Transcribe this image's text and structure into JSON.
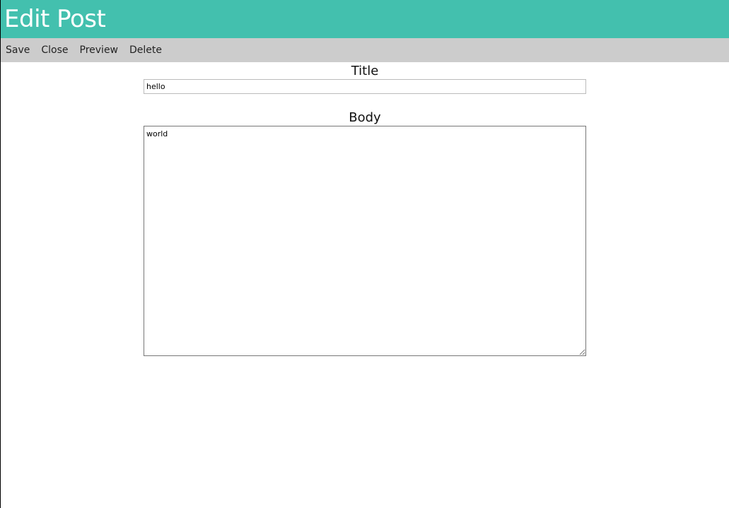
{
  "header": {
    "title": "Edit Post",
    "color": "#43c0ae"
  },
  "toolbar": {
    "save_label": "Save",
    "close_label": "Close",
    "preview_label": "Preview",
    "delete_label": "Delete"
  },
  "form": {
    "title_label": "Title",
    "title_value": "hello",
    "body_label": "Body",
    "body_value": "world"
  }
}
